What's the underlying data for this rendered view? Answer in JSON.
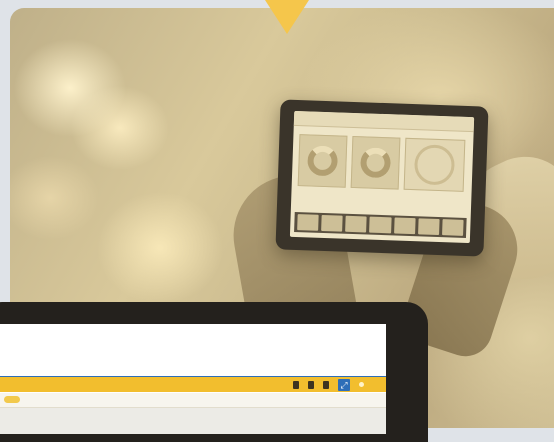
{
  "hero": {
    "accent_color": "#f5c64b",
    "photo_tablet": {
      "header_left": "",
      "header_right": ""
    }
  },
  "laptop": {
    "toolbar_color": "#f2be2e",
    "toolbar_icons": [
      "bookmark-icon",
      "bookmark-icon",
      "person-icon",
      "expand-icon",
      "dot-icon"
    ],
    "pill_label": "",
    "expand_glyph": "⤢"
  }
}
